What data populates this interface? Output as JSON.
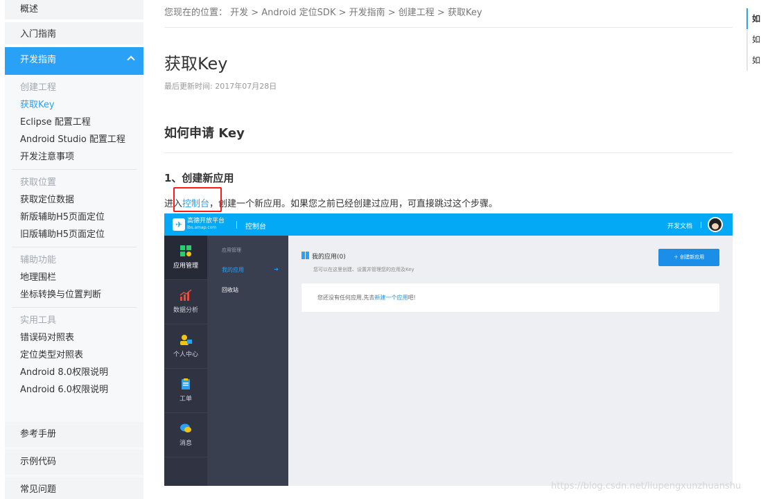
{
  "nav": {
    "overview": "概述",
    "getting_started": "入门指南",
    "dev_guide": "开发指南",
    "groups": [
      {
        "title": "创建工程",
        "items": [
          "获取Key",
          "Eclipse 配置工程",
          "Android Studio 配置工程",
          "开发注意事项"
        ],
        "active": "获取Key"
      },
      {
        "title": "获取位置",
        "items": [
          "获取定位数据",
          "新版辅助H5页面定位",
          "旧版辅助H5页面定位"
        ]
      },
      {
        "title": "辅助功能",
        "items": [
          "地理围栏",
          "坐标转换与位置判断"
        ]
      },
      {
        "title": "实用工具",
        "items": [
          "错误码对照表",
          "定位类型对照表",
          "Android 8.0权限说明",
          "Android 6.0权限说明"
        ]
      }
    ],
    "reference": "参考手册",
    "sample_code": "示例代码",
    "faq": "常见问题"
  },
  "breadcrumb": "您现在的位置： 开发 > Android 定位SDK > 开发指南 > 创建工程 > 获取Key",
  "page": {
    "title": "获取Key",
    "updated": "最后更新时间: 2017年07月28日",
    "section": "如何申请 Key",
    "step1": "1、创建新应用",
    "intro_before": "进入",
    "intro_link": "控制台",
    "intro_after": "，创建一个新应用。如果您之前已经创建过应用，可直接跳过这个步骤。"
  },
  "console": {
    "brand": "高德开放平台",
    "brand_sub": "lbs.amap.com",
    "top_console": "控制台",
    "docs": "开发文档",
    "side_icons": [
      "应用管理",
      "数据分析",
      "个人中心",
      "工单",
      "消息"
    ],
    "submenu_header": "应用管理",
    "submenu": [
      "我的应用",
      "回收站"
    ],
    "my_apps": "我的应用(0)",
    "my_apps_sub": "您可以在这里创建、设置并管理您的应用及Key",
    "create_btn": "＋ 创建新应用",
    "empty_before": "您还没有任何应用,先去",
    "empty_link": "新建一个应用",
    "empty_after": "吧!"
  },
  "toc": [
    "如",
    "如",
    "如"
  ],
  "watermark": "https://blog.csdn.net/liupengxunzhuanshu",
  "colors": {
    "accent": "#29a1f7",
    "console_top": "#03a9f4",
    "highlight_box": "#ff1a1a"
  }
}
